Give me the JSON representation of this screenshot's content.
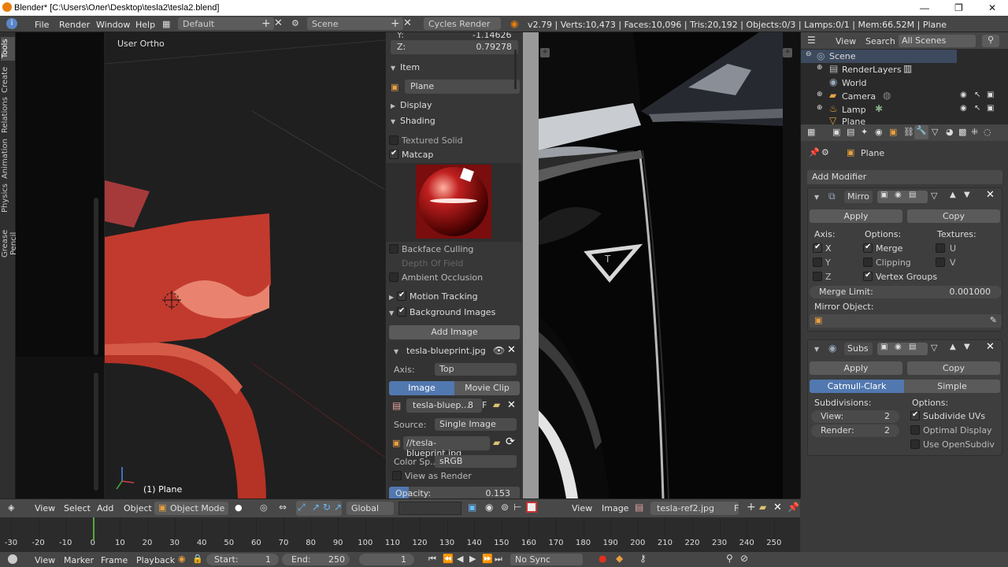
{
  "window": {
    "title": "Blender* [C:\\Users\\Олег\\Desktop\\tesla2\\tesla2.blend]",
    "minimize": "—",
    "maximize": "❐",
    "close": "✕"
  },
  "info_header": {
    "menus": [
      "File",
      "Render",
      "Window",
      "Help"
    ],
    "layout": "Default",
    "scene": "Scene",
    "engine": "Cycles Render",
    "stats": "v2.79 | Verts:10,473 | Faces:10,096 | Tris:20,192 | Objects:0/3 | Lamps:0/1 | Mem:66.52M | Plane"
  },
  "tool_tabs": [
    "Tools",
    "Create",
    "Relations",
    "Animation",
    "Physics",
    "Grease Pencil"
  ],
  "viewport": {
    "view_name": "User Ortho",
    "object_label": "(1) Plane",
    "colors": {
      "mesh": "#c0342a",
      "mesh_light": "#e86a5c",
      "bg": "#1f1f1f"
    }
  },
  "properties_panel": {
    "y_label": "Y:",
    "y_value": "-1.14626",
    "z_label": "Z:",
    "z_value": "0.79278",
    "item_header": "Item",
    "object_name": "Plane",
    "display_header": "Display",
    "shading_header": "Shading",
    "textured_solid": "Textured Solid",
    "matcap": "Matcap",
    "backface_culling": "Backface Culling",
    "depth_of_field": "Depth Of Field",
    "ambient_occlusion": "Ambient Occlusion",
    "motion_tracking": "Motion Tracking",
    "background_images": "Background Images",
    "add_image": "Add Image",
    "bg_image_name": "tesla-blueprint.jpg",
    "axis_label": "Axis:",
    "axis_value": "Top",
    "tab_image": "Image",
    "tab_movie": "Movie Clip",
    "image_datablock": "tesla-bluep...",
    "image_users": "8",
    "image_fake": "F",
    "source_label": "Source:",
    "source_value": "Single Image",
    "filepath": "//tesla-blueprint.jpg",
    "colorspace_label": "Color Sp...",
    "colorspace_value": "sRGB",
    "view_as_render": "View as Render",
    "opacity_label": "Opacity:",
    "opacity_value": "0.153",
    "opacity_fraction": 0.153
  },
  "outliner": {
    "view": "View",
    "search": "Search",
    "filter": "All Scenes",
    "items": [
      "Scene",
      "RenderLayers",
      "World",
      "Camera",
      "Lamp",
      "Plane"
    ]
  },
  "modifiers": {
    "object_name": "Plane",
    "add_modifier": "Add Modifier",
    "mirror": {
      "name": "Mirro",
      "apply": "Apply",
      "copy": "Copy",
      "axis_label": "Axis:",
      "options_label": "Options:",
      "textures_label": "Textures:",
      "x": "X",
      "y": "Y",
      "z": "Z",
      "merge": "Merge",
      "clipping": "Clipping",
      "vertex_groups": "Vertex Groups",
      "u": "U",
      "v": "V",
      "merge_limit_label": "Merge Limit:",
      "merge_limit_value": "0.001000",
      "mirror_object_label": "Mirror Object:"
    },
    "subsurf": {
      "name": "Subs",
      "apply": "Apply",
      "copy": "Copy",
      "catmull": "Catmull-Clark",
      "simple": "Simple",
      "subdivisions_label": "Subdivisions:",
      "options_label": "Options:",
      "view_label": "View:",
      "view_value": "2",
      "render_label": "Render:",
      "render_value": "2",
      "subdivide_uvs": "Subdivide UVs",
      "optimal_display": "Optimal Display",
      "use_opensubdiv": "Use OpenSubdiv"
    }
  },
  "view3d_header": {
    "menus": [
      "View",
      "Select",
      "Add",
      "Object"
    ],
    "mode": "Object Mode",
    "orientation": "Global"
  },
  "image_header": {
    "menus": [
      "View",
      "Image"
    ],
    "image_name": "tesla-ref2.jpg",
    "fake": "F"
  },
  "timeline": {
    "ticks": [
      "-30",
      "-20",
      "-10",
      "0",
      "10",
      "20",
      "30",
      "40",
      "50",
      "60",
      "70",
      "80",
      "90",
      "100",
      "110",
      "120",
      "130",
      "140",
      "150",
      "160",
      "170",
      "180",
      "190",
      "200",
      "210",
      "220",
      "230",
      "240",
      "250"
    ],
    "menus": [
      "View",
      "Marker",
      "Frame",
      "Playback"
    ],
    "start_label": "Start:",
    "start_value": "1",
    "end_label": "End:",
    "end_value": "250",
    "current_frame": "1",
    "sync": "No Sync"
  }
}
